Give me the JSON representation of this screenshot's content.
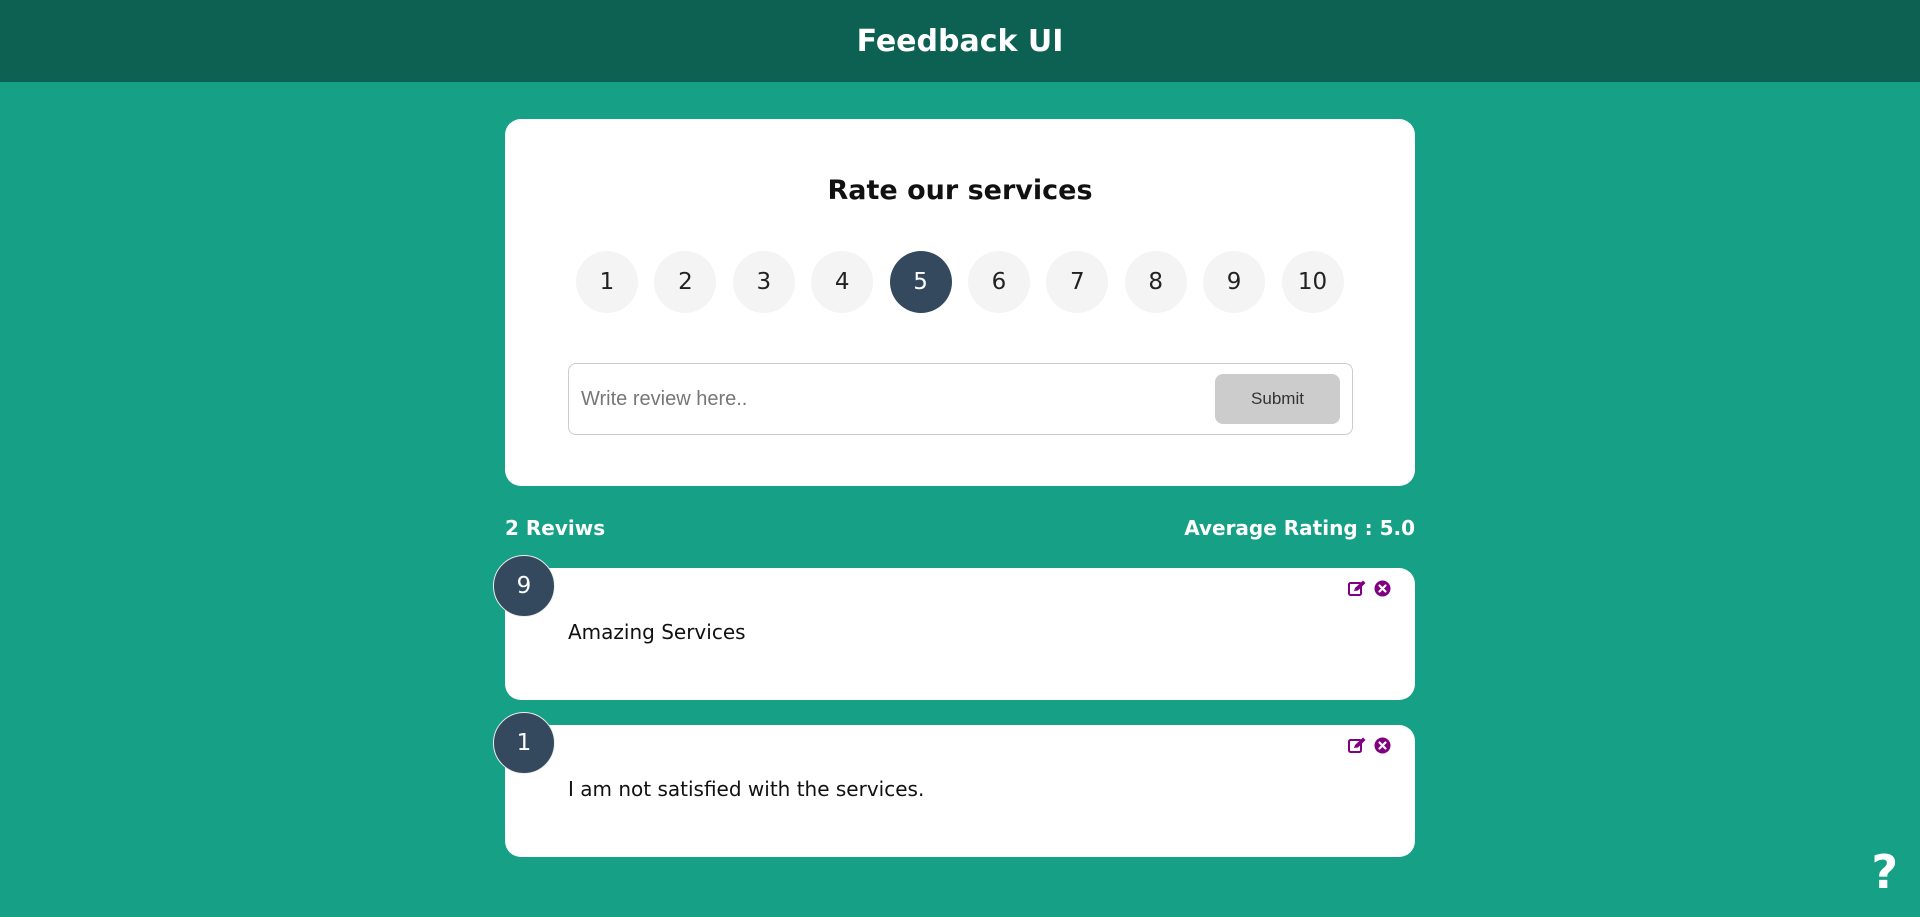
{
  "header": {
    "title": "Feedback UI"
  },
  "form": {
    "heading": "Rate our services",
    "ratings": [
      "1",
      "2",
      "3",
      "4",
      "5",
      "6",
      "7",
      "8",
      "9",
      "10"
    ],
    "selected_rating": "5",
    "review_placeholder": "Write review here..",
    "submit_label": "Submit"
  },
  "stats": {
    "count_label": "2 Reviws",
    "average_label": "Average Rating : 5.0"
  },
  "reviews": [
    {
      "rating": "9",
      "text": "Amazing Services"
    },
    {
      "rating": "1",
      "text": "I am not satisfied with the services."
    }
  ],
  "help": {
    "symbol": "?"
  },
  "colors": {
    "background": "#16a085",
    "header": "#0d6152",
    "selected": "#34495e",
    "icon": "#800080"
  }
}
